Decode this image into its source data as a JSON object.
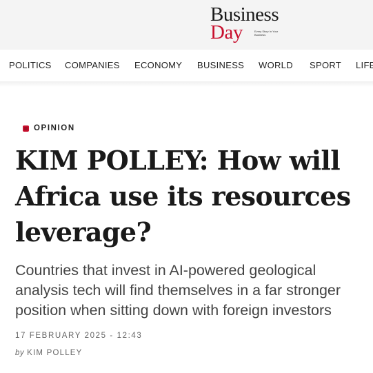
{
  "brand": {
    "line1": "Business",
    "line2": "Day",
    "tagline": "Every Story In Your Business"
  },
  "nav": {
    "items": [
      "POLITICS",
      "COMPANIES",
      "ECONOMY",
      "BUSINESS",
      "WORLD",
      "SPORT",
      "LIFE"
    ]
  },
  "article": {
    "category": "OPINION",
    "headline": "KIM POLLEY: How will Africa use its resources leverage?",
    "standfirst": "Countries that invest in AI-powered geological analysis tech will find themselves in a far stronger position when sitting down with foreign investors",
    "date": "17 FEBRUARY 2025 - 12:43",
    "by": "by",
    "author": "KIM POLLEY"
  },
  "colors": {
    "brand_red": "#c8102e",
    "masthead_bg": "#f4f4f4"
  },
  "icons": {
    "category": "opinion-square-icon"
  }
}
